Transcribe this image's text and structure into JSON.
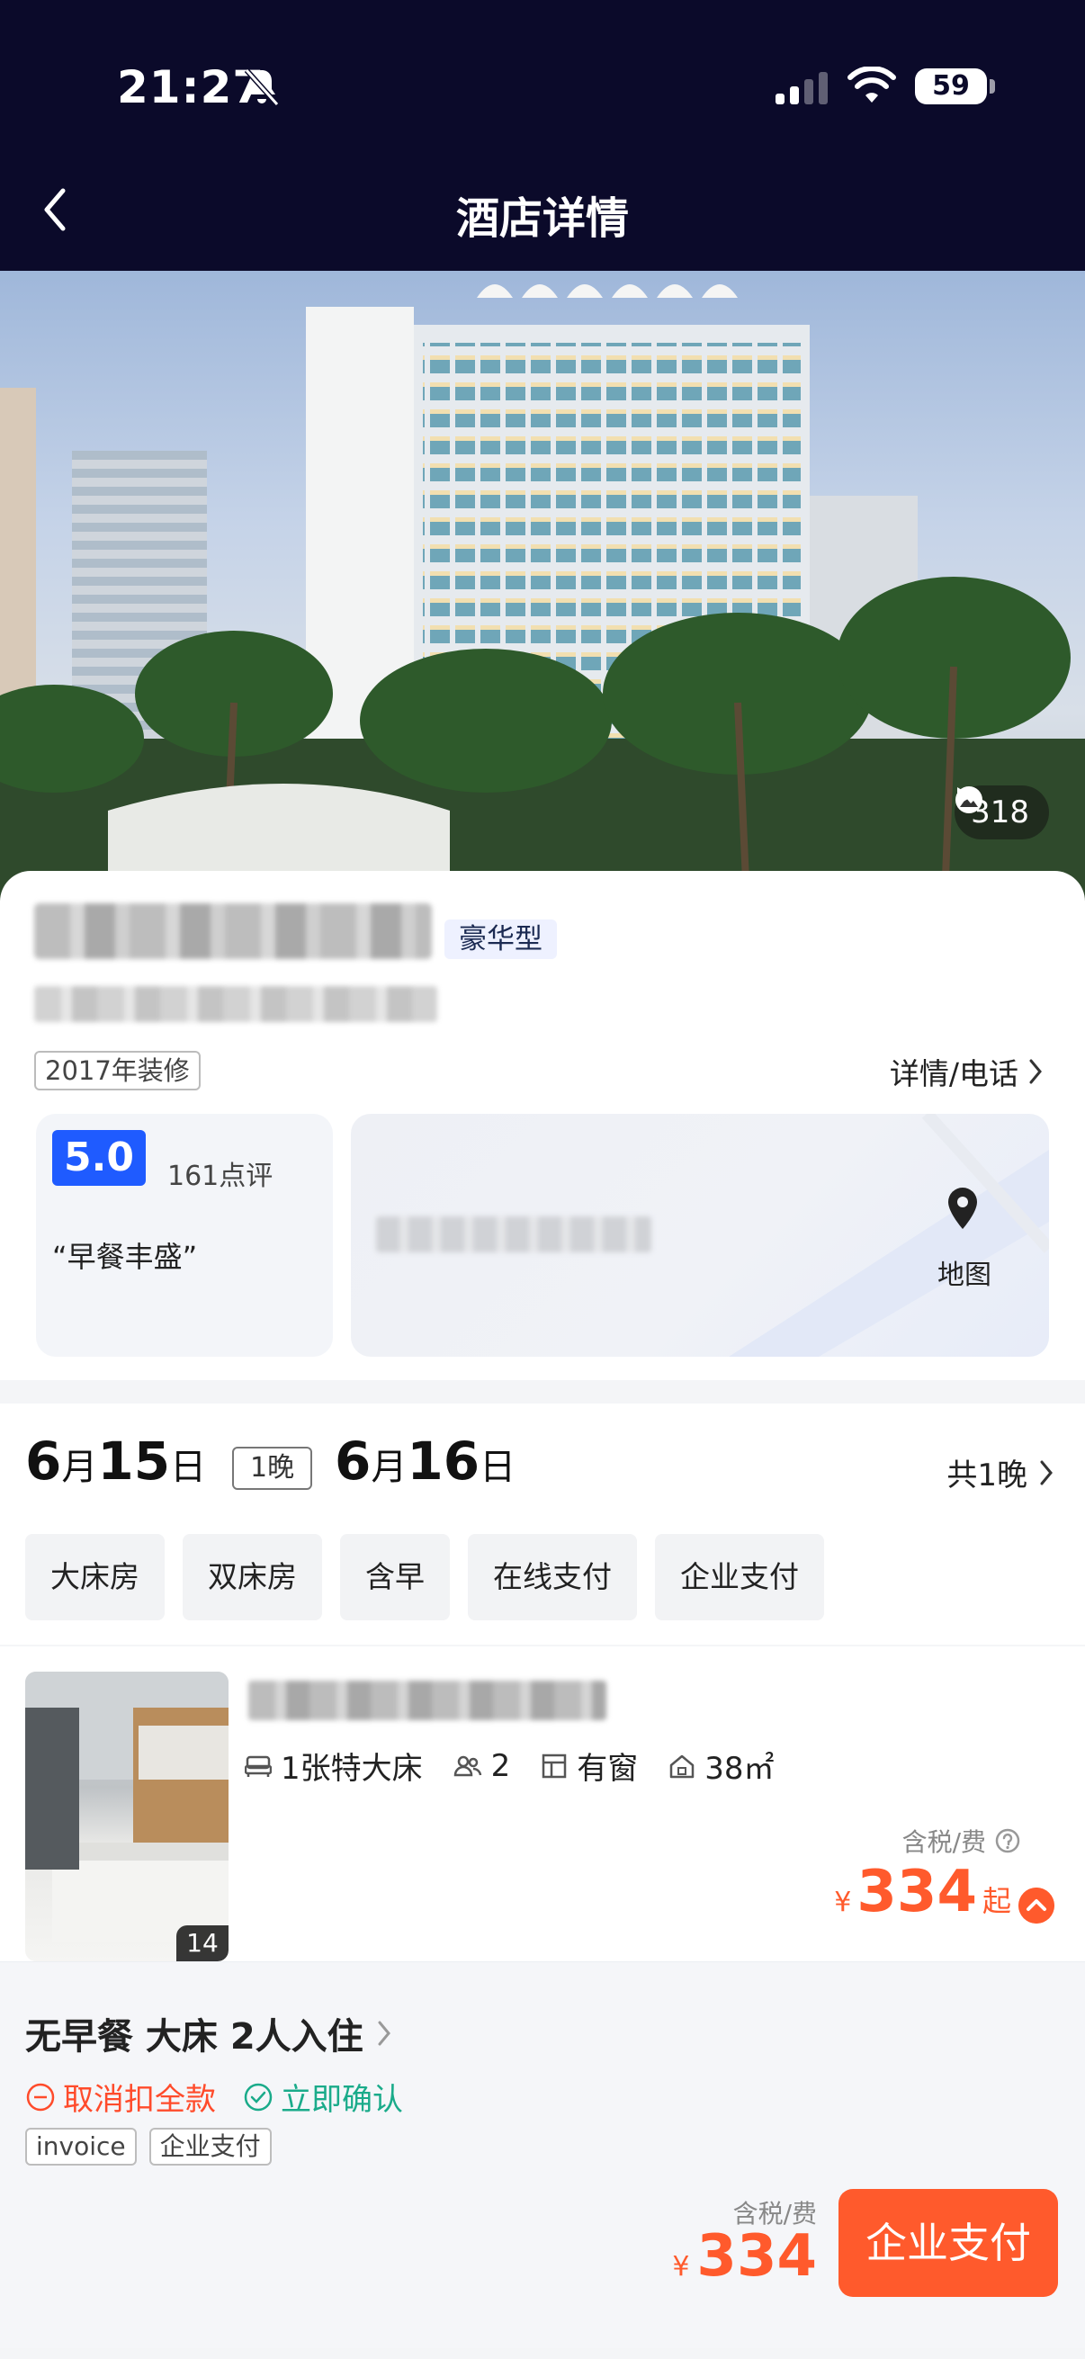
{
  "status_bar": {
    "time": "21:27",
    "battery": "59"
  },
  "nav": {
    "title": "酒店详情"
  },
  "hero": {
    "photo_count": "318"
  },
  "hotel": {
    "tier": "豪华型",
    "renovation": "2017年装修",
    "details_link": "详情/电话",
    "score": "5.0",
    "review_count": "161点评",
    "review_quote": "“早餐丰盛”",
    "map_label": "地图"
  },
  "stay": {
    "checkin_month": "6",
    "checkin_day": "15",
    "month_unit": "月",
    "day_unit": "日",
    "nights_tag": "1晚",
    "checkout_month": "6",
    "checkout_day": "16",
    "total_nights": "共1晚"
  },
  "filters": [
    "大床房",
    "双床房",
    "含早",
    "在线支付",
    "企业支付"
  ],
  "room": {
    "image_count": "14",
    "bed": "1张特大床",
    "guests": "2",
    "window": "有窗",
    "area": "38㎡",
    "tax_note": "含税/费",
    "currency": "¥",
    "price": "334",
    "price_suffix": "起"
  },
  "rate_plan": {
    "title": "无早餐 大床 2人入住",
    "cancel_policy": "取消扣全款",
    "confirm_policy": "立即确认",
    "tags": [
      "invoice",
      "企业支付"
    ],
    "tax_note": "含税/费",
    "currency": "¥",
    "price": "334",
    "pay_button": "企业支付"
  },
  "colors": {
    "nav_bg": "#0b0a2a",
    "accent": "#ff5a2c",
    "score_blue": "#1f5bff",
    "green": "#1aab8a"
  }
}
